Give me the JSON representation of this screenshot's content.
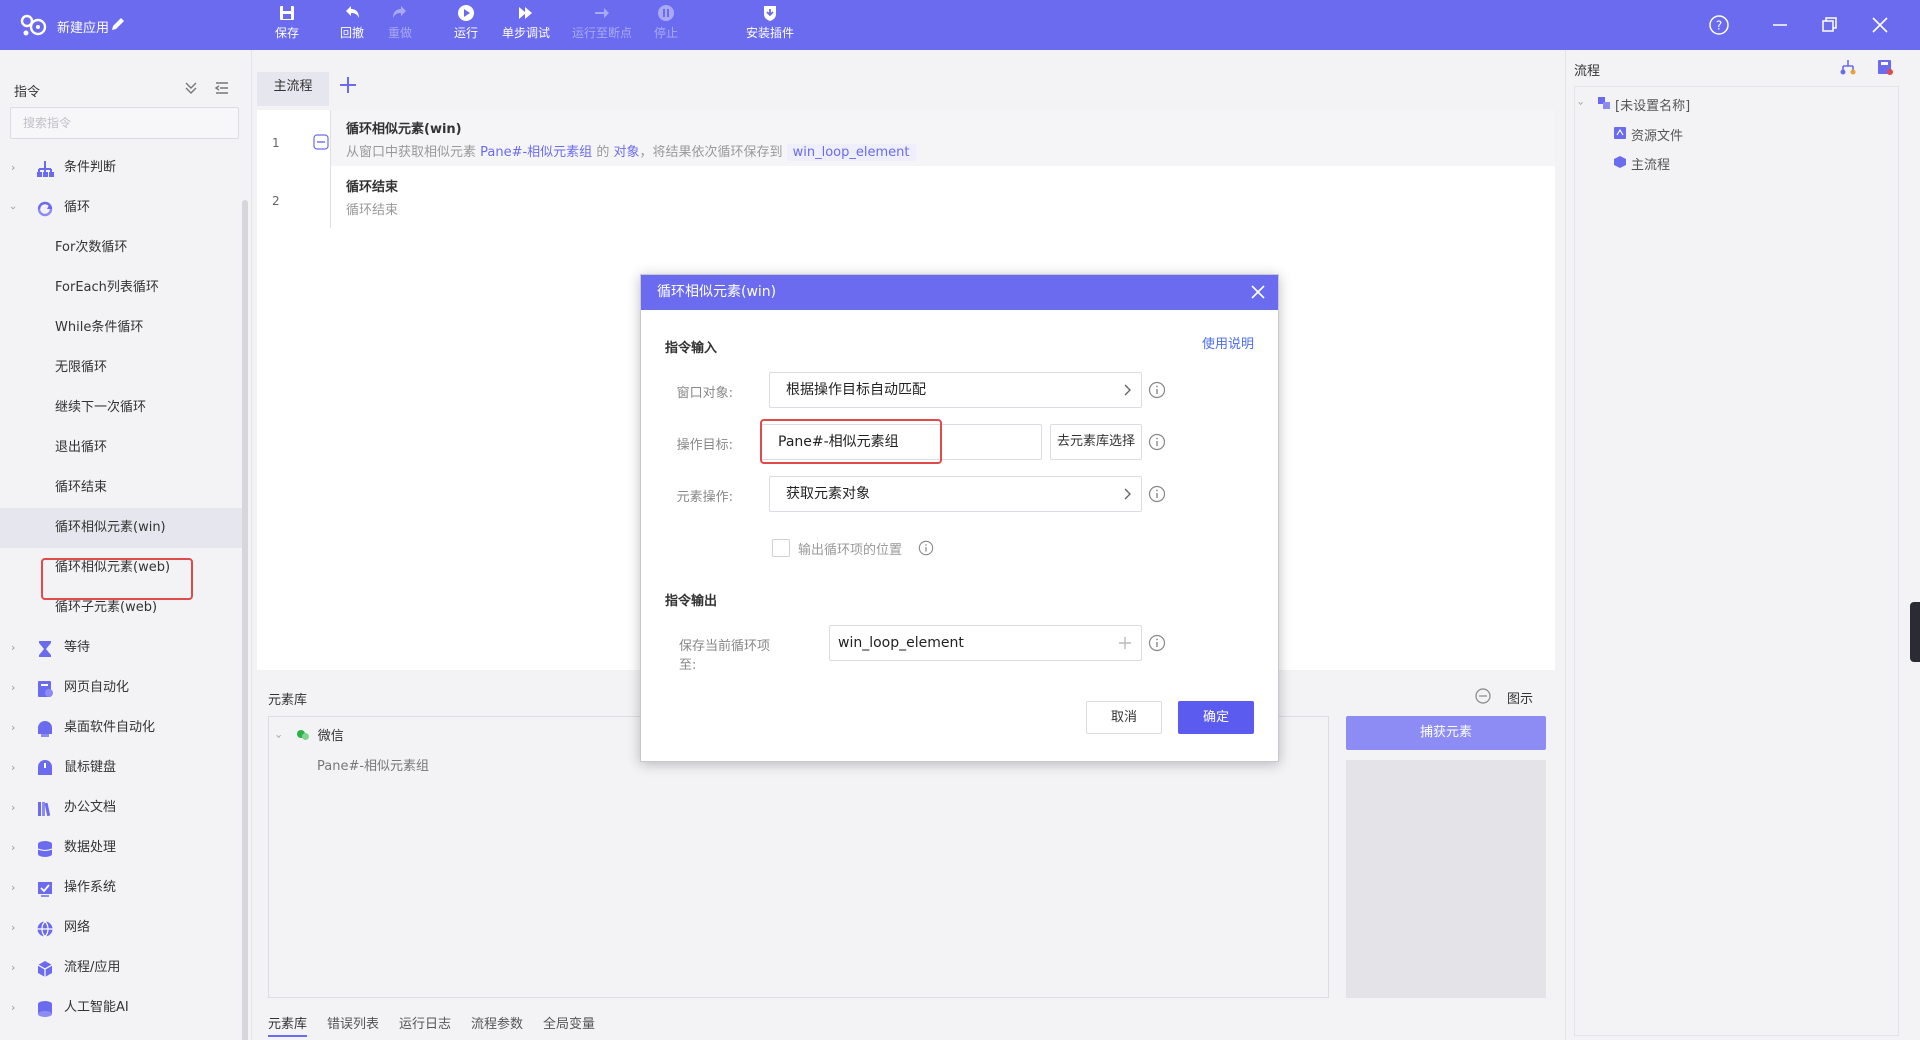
{
  "app": {
    "title": "新建应用"
  },
  "toolbar": [
    {
      "key": "save",
      "label": "保存",
      "disabled": false,
      "icon": "save-icon"
    },
    {
      "key": "undo",
      "label": "回撤",
      "disabled": false,
      "icon": "undo-icon"
    },
    {
      "key": "redo",
      "label": "重做",
      "disabled": true,
      "icon": "redo-icon"
    },
    {
      "key": "run",
      "label": "运行",
      "disabled": false,
      "icon": "play-icon"
    },
    {
      "key": "step",
      "label": "单步调试",
      "disabled": false,
      "icon": "step-debug-icon"
    },
    {
      "key": "run_to_bp",
      "label": "运行至断点",
      "disabled": true,
      "icon": "run-to-breakpoint-icon"
    },
    {
      "key": "stop",
      "label": "停止",
      "disabled": true,
      "icon": "stop-icon"
    },
    {
      "key": "plugin",
      "label": "安装插件",
      "disabled": false,
      "icon": "plugin-icon"
    }
  ],
  "left": {
    "title": "指令",
    "search_placeholder": "搜索指令",
    "tree": [
      {
        "label": "条件判断",
        "type": "category",
        "icon": "condition-icon"
      },
      {
        "label": "循环",
        "type": "category-open",
        "icon": "loop-icon"
      },
      {
        "label": "For次数循环",
        "type": "sub"
      },
      {
        "label": "ForEach列表循环",
        "type": "sub"
      },
      {
        "label": "While条件循环",
        "type": "sub"
      },
      {
        "label": "无限循环",
        "type": "sub"
      },
      {
        "label": "继续下一次循环",
        "type": "sub"
      },
      {
        "label": "退出循环",
        "type": "sub"
      },
      {
        "label": "循环结束",
        "type": "sub"
      },
      {
        "label": "循环相似元素(win)",
        "type": "sub-active"
      },
      {
        "label": "循环相似元素(web)",
        "type": "sub"
      },
      {
        "label": "循环子元素(web)",
        "type": "sub"
      },
      {
        "label": "等待",
        "type": "category",
        "icon": "hourglass-icon"
      },
      {
        "label": "网页自动化",
        "type": "category",
        "icon": "web-icon"
      },
      {
        "label": "桌面软件自动化",
        "type": "category",
        "icon": "desktop-icon"
      },
      {
        "label": "鼠标键盘",
        "type": "category",
        "icon": "mouse-keyboard-icon"
      },
      {
        "label": "办公文档",
        "type": "category",
        "icon": "books-icon"
      },
      {
        "label": "数据处理",
        "type": "category",
        "icon": "database-icon"
      },
      {
        "label": "操作系统",
        "type": "category",
        "icon": "os-icon"
      },
      {
        "label": "网络",
        "type": "category",
        "icon": "globe-icon"
      },
      {
        "label": "流程/应用",
        "type": "category",
        "icon": "cube-icon"
      },
      {
        "label": "人工智能AI",
        "type": "category",
        "icon": "ai-icon"
      }
    ]
  },
  "main": {
    "tab": "主流程",
    "steps": [
      {
        "no": "1",
        "title": "循环相似元素(win)",
        "desc_pre": "从窗口中获取相似元素 ",
        "desc_target": "Pane#-相似元素组",
        "desc_mid": " 的 ",
        "desc_obj": "对象",
        "desc_post": "，将结果依次循环保存到",
        "desc_var": "win_loop_element"
      },
      {
        "no": "2",
        "title": "循环结束",
        "desc": "循环结束"
      }
    ]
  },
  "bottom": {
    "title": "元素库",
    "collapse_label": "图示",
    "group": "微信",
    "item": "Pane#-相似元素组",
    "capture_label": "捕获元素",
    "tabs": [
      "元素库",
      "错误列表",
      "运行日志",
      "流程参数",
      "全局变量"
    ]
  },
  "right": {
    "title": "流程",
    "root": "[未设置名称]",
    "nodes": [
      "资源文件",
      "主流程"
    ]
  },
  "modal": {
    "title": "循环相似元素(win)",
    "input_section": "指令输入",
    "help_link": "使用说明",
    "window_label": "窗口对象:",
    "window_value": "根据操作目标自动匹配",
    "target_label": "操作目标:",
    "target_value": "Pane#-相似元素组",
    "target_btn": "去元素库选择",
    "op_label": "元素操作:",
    "op_value": "获取元素对象",
    "checkbox_label": "输出循环项的位置",
    "output_section": "指令输出",
    "save_label": "保存当前循环项至:",
    "save_value": "win_loop_element",
    "cancel": "取消",
    "ok": "确定"
  },
  "colors": {
    "accent": "#6b6bf0",
    "highlight": "#e24a4a"
  }
}
